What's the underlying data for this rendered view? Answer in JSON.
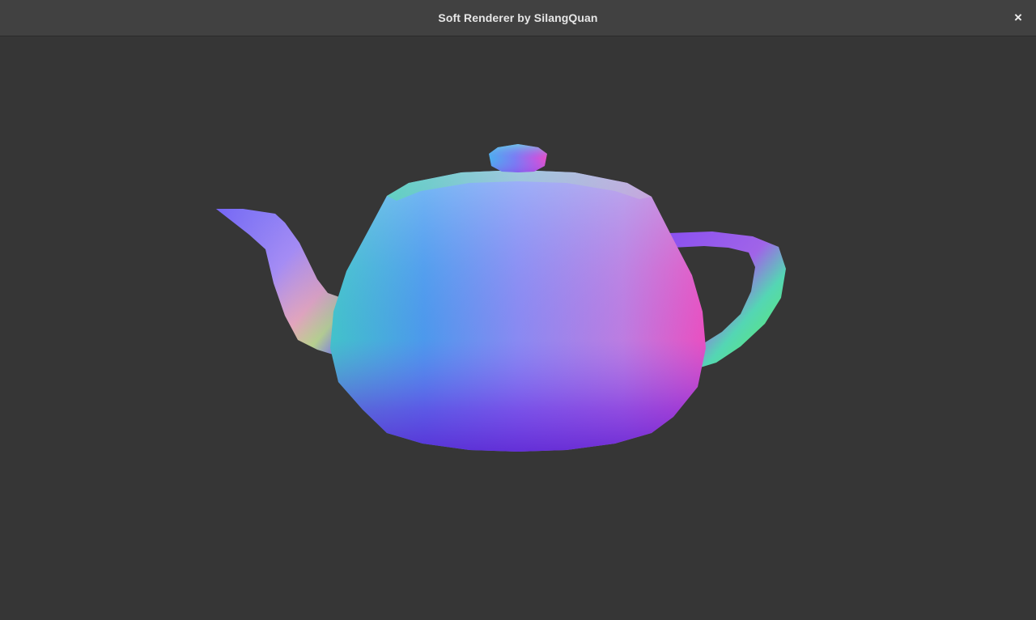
{
  "window": {
    "title": "Soft Renderer by SilangQuan",
    "close_glyph": "×"
  },
  "viewport": {
    "background_color": "#363636",
    "content": "teapot",
    "shading": "normal-map colors",
    "colors": {
      "cyan": "#4fbfe0",
      "blue": "#5a6ff0",
      "violet": "#8a3ae8",
      "magenta": "#e040c0",
      "lavender": "#a4a8ec",
      "green": "#5ae89a"
    }
  }
}
